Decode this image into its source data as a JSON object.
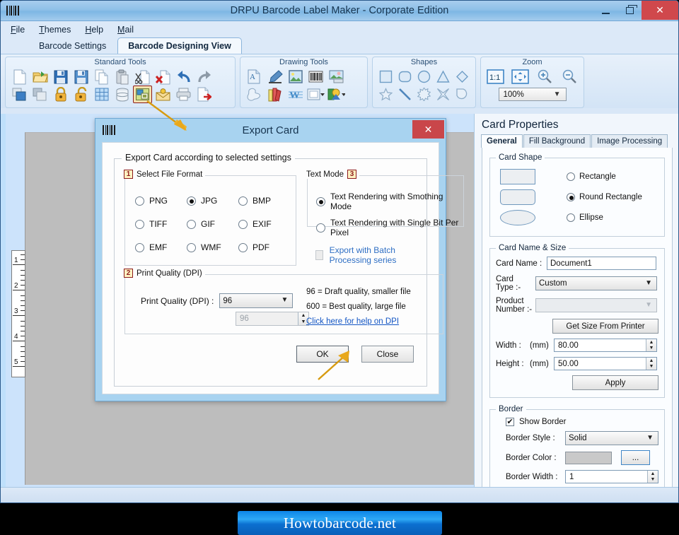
{
  "window": {
    "title": "DRPU Barcode Label Maker - Corporate Edition",
    "minimize": "–",
    "maximize": "❐",
    "close": "✕"
  },
  "menu": {
    "items": [
      "File",
      "Themes",
      "Help",
      "Mail"
    ]
  },
  "tabs": [
    {
      "label": "Barcode Settings",
      "active": false
    },
    {
      "label": "Barcode Designing View",
      "active": true
    }
  ],
  "ribbon": {
    "groups": [
      {
        "label": "Standard Tools"
      },
      {
        "label": "Drawing Tools"
      },
      {
        "label": "Shapes"
      },
      {
        "label": "Zoom"
      }
    ],
    "zoom_value": "100%"
  },
  "ruler": {
    "numbers": [
      "1",
      "2",
      "3",
      "4",
      "5"
    ]
  },
  "dialog": {
    "title": "Export Card",
    "close": "✕",
    "group_title": "Export Card according to selected settings",
    "file_format": {
      "badge": "1",
      "legend": "Select File Format",
      "options": [
        {
          "label": "PNG",
          "selected": false
        },
        {
          "label": "JPG",
          "selected": true
        },
        {
          "label": "BMP",
          "selected": false
        },
        {
          "label": "TIFF",
          "selected": false
        },
        {
          "label": "GIF",
          "selected": false
        },
        {
          "label": "EXIF",
          "selected": false
        },
        {
          "label": "EMF",
          "selected": false
        },
        {
          "label": "WMF",
          "selected": false
        },
        {
          "label": "PDF",
          "selected": false
        }
      ]
    },
    "text_mode": {
      "badge": "3",
      "legend": "Text Mode",
      "options": [
        {
          "label": "Text Rendering with Smothing Mode",
          "selected": true
        },
        {
          "label": "Text Rendering with Single Bit Per Pixel",
          "selected": false
        }
      ]
    },
    "batch": {
      "label": "Export with Batch Processing series",
      "checked": false,
      "enabled": false
    },
    "print_quality": {
      "badge": "2",
      "legend": "Print Quality (DPI)",
      "field_label": "Print Quality (DPI) :",
      "combo_value": "96",
      "spin_value": "96",
      "hint_1": "96 = Draft quality, smaller file",
      "hint_2": "600  = Best quality, large file",
      "help_link": "Click here for help on DPI"
    },
    "buttons": {
      "ok": "OK",
      "close": "Close"
    }
  },
  "card_properties": {
    "title": "Card Properties",
    "tabs": [
      {
        "label": "General",
        "active": true
      },
      {
        "label": "Fill Background",
        "active": false
      },
      {
        "label": "Image Processing",
        "active": false
      }
    ],
    "card_shape": {
      "legend": "Card Shape",
      "options": [
        {
          "label": "Rectangle",
          "selected": false
        },
        {
          "label": "Round Rectangle",
          "selected": true
        },
        {
          "label": "Ellipse",
          "selected": false
        }
      ]
    },
    "name_size": {
      "legend": "Card Name & Size",
      "card_name_label": "Card Name :",
      "card_name_value": "Document1",
      "card_type_label": "Card\nType :-",
      "card_type_label_1": "Card",
      "card_type_label_2": "Type :-",
      "card_type_value": "Custom",
      "product_number_label_1": "Product",
      "product_number_label_2": "Number :-",
      "product_number_value": "",
      "get_size_button": "Get Size From Printer",
      "width_label": "Width :",
      "width_unit": "(mm)",
      "width_value": "80.00",
      "height_label": "Height :",
      "height_unit": "(mm)",
      "height_value": "50.00",
      "apply_button": "Apply"
    },
    "border": {
      "legend": "Border",
      "show_border_label": "Show Border",
      "show_border_checked": true,
      "style_label": "Border Style :",
      "style_value": "Solid",
      "color_label": "Border Color :",
      "color_value": "#c9c9c9",
      "color_button": "...",
      "width_label": "Border Width :",
      "width_value": "1"
    }
  },
  "banner": {
    "text": "Howtobarcode.net"
  },
  "colors": {
    "title_bar": "#8fc0e8",
    "accent": "#1255c4",
    "close_red": "#d0484c",
    "arrow": "#d79b10",
    "highlight_border": "#8c1b1b"
  }
}
